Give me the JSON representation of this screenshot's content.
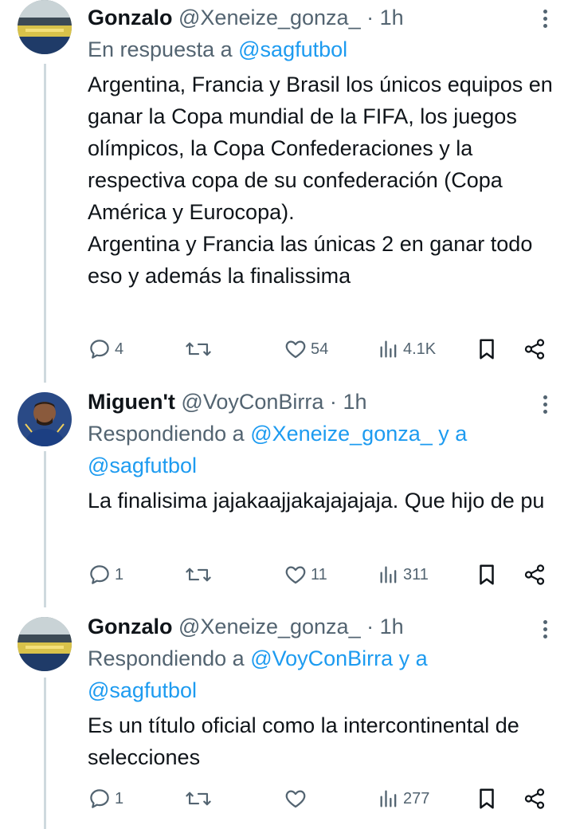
{
  "tweets": [
    {
      "name": "Gonzalo",
      "handle": "@Xeneize_gonza_",
      "separator": "·",
      "time": "1h",
      "reply_prefix": "En respuesta a",
      "reply_mentions_line1": "@sagfutbol",
      "reply_line2": "",
      "body": [
        "Argentina, Francia y Brasil los únicos equipos en ganar la Copa mundial de la FIFA, los juegos olímpicos, la Copa Confederaciones y la respectiva copa de su confederación (Copa América y Eurocopa).",
        "Argentina y Francia las únicas 2 en ganar todo eso y además la finalissima"
      ],
      "replies": "4",
      "retweets": "",
      "likes": "54",
      "views": "4.1K"
    },
    {
      "name": "Miguen't",
      "handle": "@VoyConBirra",
      "separator": "·",
      "time": "1h",
      "reply_prefix": "Respondiendo a",
      "reply_mentions_line1": "@Xeneize_gonza_ y a",
      "reply_line2": "@sagfutbol",
      "body": [
        "La finalisima jajakaajjakajajajaja. Que hijo de pu"
      ],
      "replies": "1",
      "retweets": "",
      "likes": "11",
      "views": "311"
    },
    {
      "name": "Gonzalo",
      "handle": "@Xeneize_gonza_",
      "separator": "·",
      "time": "1h",
      "reply_prefix": "Respondiendo a",
      "reply_mentions_line1": "@VoyConBirra y a",
      "reply_line2": "@sagfutbol",
      "body": [
        "Es un título oficial como la intercontinental de selecciones"
      ],
      "replies": "1",
      "retweets": "",
      "likes": "",
      "views": "277"
    }
  ],
  "icons": {
    "reply": "reply-icon",
    "retweet": "retweet-icon",
    "like": "heart-icon",
    "views": "views-icon",
    "bookmark": "bookmark-icon",
    "share": "share-icon",
    "more": "more-icon"
  },
  "colors": {
    "text": "#0f1419",
    "secondary": "#536471",
    "link": "#1d9bf0",
    "thread_line": "#cfd9de"
  }
}
